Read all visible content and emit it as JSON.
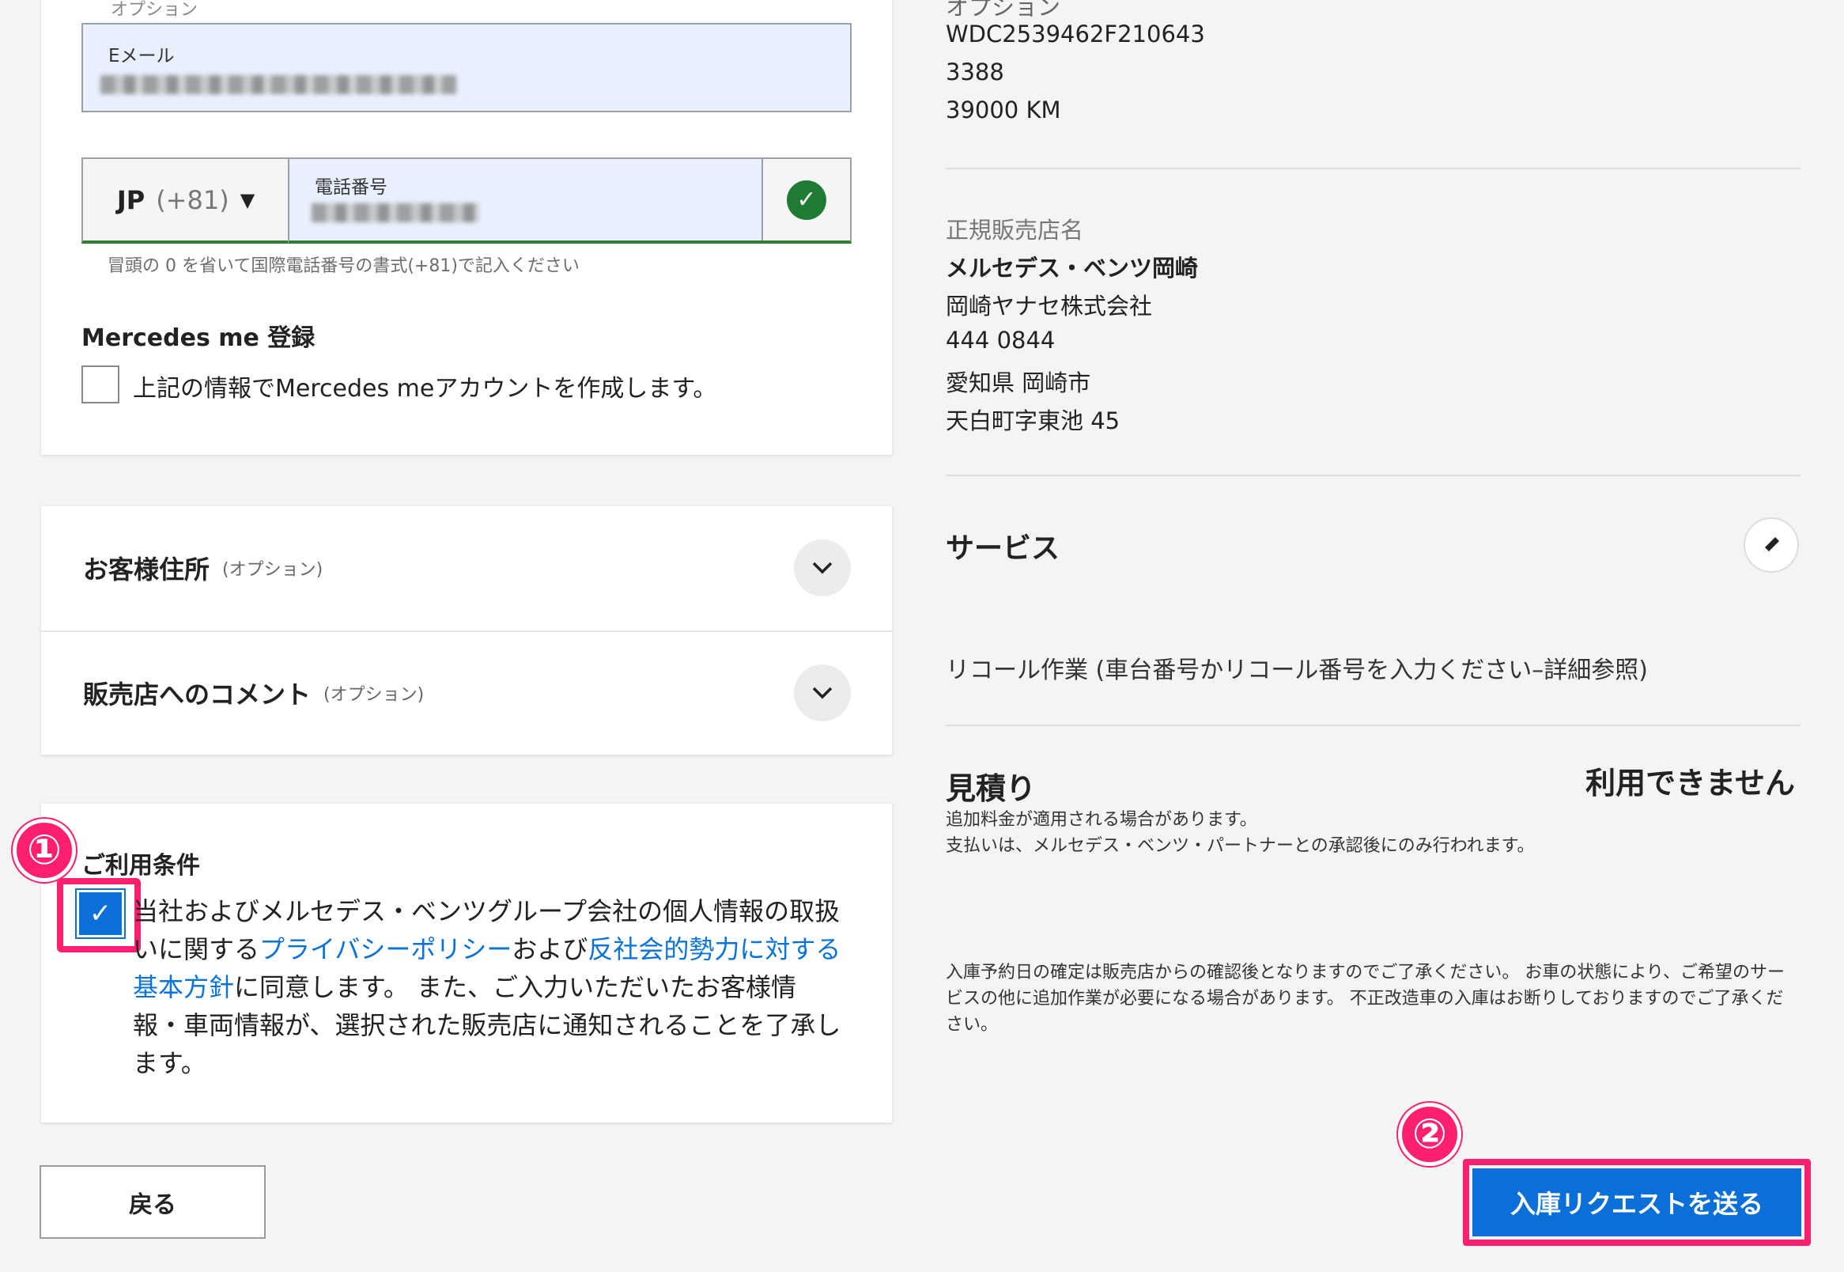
{
  "contact": {
    "cut_label": "オプション",
    "email_label": "Eメール",
    "phone_country_code": "JP",
    "phone_dial_code": "(+81)",
    "phone_label": "電話番号",
    "phone_hint": "冒頭の 0 を省いて国際電話番号の書式(+81)で記入ください",
    "mercedes_me_title": "Mercedes me 登録",
    "mercedes_me_label": "上記の情報でMercedes meアカウントを作成します。"
  },
  "accordion": [
    {
      "title": "お客様住所",
      "optional": "(オプション)"
    },
    {
      "title": "販売店へのコメント",
      "optional": "(オプション)"
    }
  ],
  "terms": {
    "title": "ご利用条件",
    "text_1": "当社およびメルセデス・ベンツグループ会社の個人情報の取扱いに関する",
    "link_1": "プライバシーポリシー",
    "text_2": "および",
    "link_2": "反社会的勢力に対する基本方針",
    "text_3": "に同意します。 また、ご入力いただいたお客様情報・車両情報が、選択された販売店に通知されることを了承します。"
  },
  "annotations": {
    "badge_1": "①",
    "badge_2": "②"
  },
  "buttons": {
    "back": "戻る",
    "submit": "入庫リクエストを送る"
  },
  "vehicle": {
    "cut_label": "オプション",
    "vin": "WDC2539462F210643",
    "number": "3388",
    "mileage": "39000 KM"
  },
  "dealer": {
    "label": "正規販売店名",
    "name": "メルセデス・ベンツ岡崎",
    "company": "岡崎ヤナセ株式会社",
    "postal": "444 0844",
    "city": "愛知県 岡崎市",
    "street": "天白町字東池 45"
  },
  "service": {
    "title": "サービス",
    "item": "リコール作業 (車台番号かリコール番号を入力ください–詳細参照)"
  },
  "estimate": {
    "title": "見積り",
    "value": "利用できません",
    "note_1": "追加料金が適用される場合があります。",
    "note_2": "支払いは、メルセデス・ベンツ・パートナーとの承認後にのみ行われます。"
  },
  "disclaimer": "入庫予約日の確定は販売店からの確認後となりますのでご了承ください。 お車の状態により、ご希望のサービスの他に追加作業が必要になる場合があります。 不正改造車の入庫はお断りしておりますのでご了承ください。"
}
